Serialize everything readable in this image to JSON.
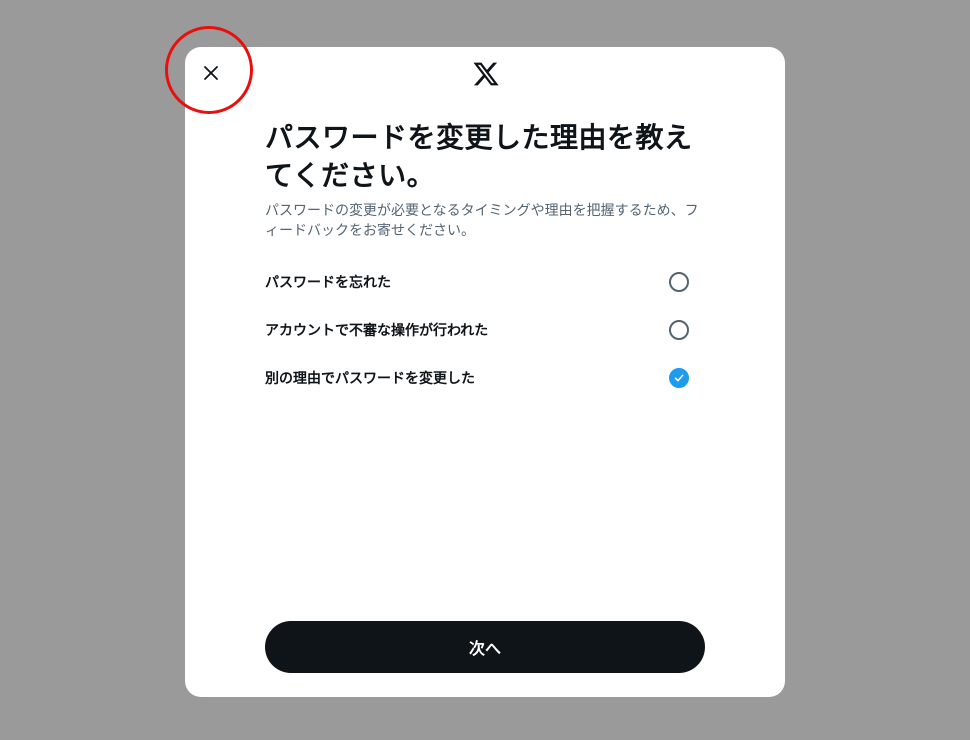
{
  "dialog": {
    "close_icon": "close-icon",
    "logo_icon": "x-logo-icon",
    "title": "パスワードを変更した理由を教えてください。",
    "subtitle": "パスワードの変更が必要となるタイミングや理由を把握するため、フィードバックをお寄せください。",
    "options": [
      {
        "label": "パスワードを忘れた",
        "checked": false
      },
      {
        "label": "アカウントで不審な操作が行われた",
        "checked": false
      },
      {
        "label": "別の理由でパスワードを変更した",
        "checked": true
      }
    ],
    "next_label": "次へ"
  },
  "colors": {
    "overlay": "#9a9a9a",
    "text_primary": "#0f1419",
    "text_secondary": "#536471",
    "accent": "#1d9bf0",
    "button_bg": "#0f1419",
    "annotation": "#e8100c"
  }
}
